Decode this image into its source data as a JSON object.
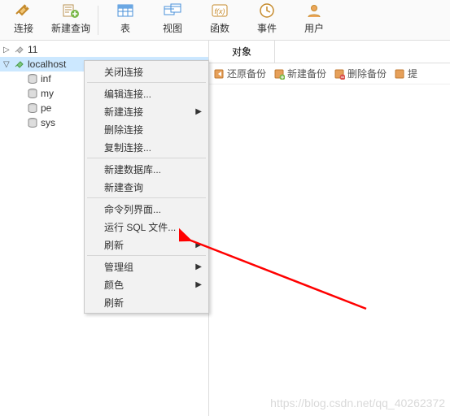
{
  "toolbar": [
    {
      "name": "connect",
      "label": "连接",
      "icon": "plug"
    },
    {
      "name": "new-query",
      "label": "新建查询",
      "icon": "new-query"
    },
    {
      "name": "table",
      "label": "表",
      "icon": "table"
    },
    {
      "name": "view",
      "label": "视图",
      "icon": "view"
    },
    {
      "name": "function",
      "label": "函数",
      "icon": "function"
    },
    {
      "name": "event",
      "label": "事件",
      "icon": "event"
    },
    {
      "name": "user",
      "label": "用户",
      "icon": "user"
    }
  ],
  "tree": {
    "items": [
      {
        "label": "11",
        "icon": "conn-closed",
        "disclosure": "▷",
        "indent": 0
      },
      {
        "label": "localhost",
        "icon": "conn-open",
        "disclosure": "▽",
        "indent": 0,
        "selected": true
      },
      {
        "label": "inf",
        "icon": "db",
        "indent": 1
      },
      {
        "label": "my",
        "icon": "db",
        "indent": 1
      },
      {
        "label": "pe",
        "icon": "db",
        "indent": 1
      },
      {
        "label": "sys",
        "icon": "db",
        "indent": 1
      }
    ]
  },
  "tab": {
    "label": "对象"
  },
  "actions": [
    {
      "name": "restore-backup",
      "label": "还原备份",
      "icon": "restore"
    },
    {
      "name": "new-backup",
      "label": "新建备份",
      "icon": "new-backup"
    },
    {
      "name": "delete-backup",
      "label": "删除备份",
      "icon": "delete-backup"
    },
    {
      "name": "more",
      "label": "提",
      "icon": "more"
    }
  ],
  "context_menu": [
    {
      "type": "item",
      "label": "关闭连接"
    },
    {
      "type": "sep"
    },
    {
      "type": "item",
      "label": "编辑连接..."
    },
    {
      "type": "item",
      "label": "新建连接",
      "submenu": true
    },
    {
      "type": "item",
      "label": "删除连接"
    },
    {
      "type": "item",
      "label": "复制连接..."
    },
    {
      "type": "sep"
    },
    {
      "type": "item",
      "label": "新建数据库..."
    },
    {
      "type": "item",
      "label": "新建查询"
    },
    {
      "type": "sep"
    },
    {
      "type": "item",
      "label": "命令列界面..."
    },
    {
      "type": "item",
      "label": "运行 SQL 文件..."
    },
    {
      "type": "item",
      "label": "刷新",
      "submenu": true
    },
    {
      "type": "sep"
    },
    {
      "type": "item",
      "label": "管理组",
      "submenu": true
    },
    {
      "type": "item",
      "label": "颜色",
      "submenu": true
    },
    {
      "type": "item",
      "label": "刷新"
    }
  ],
  "watermark": "https://blog.csdn.net/qq_40262372"
}
